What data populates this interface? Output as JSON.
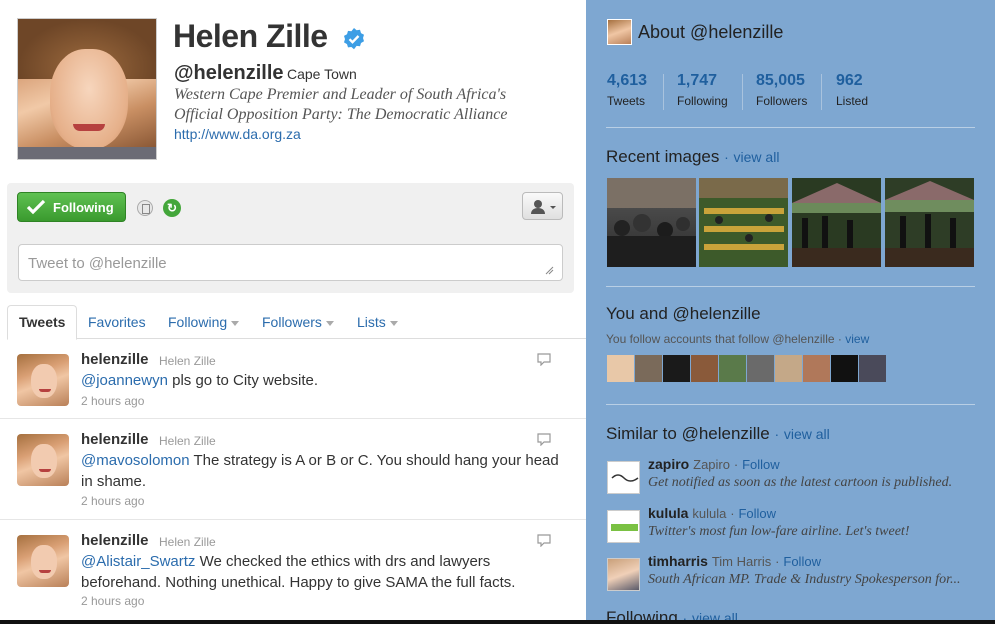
{
  "profile": {
    "name": "Helen Zille",
    "handle": "@helenzille",
    "location": "Cape Town",
    "bio": "Western Cape Premier and Leader of South Africa's Official Opposition Party: The Democratic Alliance",
    "url": "http://www.da.org.za",
    "verified": true
  },
  "actions": {
    "following_label": "Following",
    "tweet_placeholder": "Tweet to @helenzille"
  },
  "tabs": [
    {
      "label": "Tweets",
      "active": true
    },
    {
      "label": "Favorites"
    },
    {
      "label": "Following"
    },
    {
      "label": "Followers"
    },
    {
      "label": "Lists"
    }
  ],
  "tweets": [
    {
      "user": "helenzille",
      "name": "Helen Zille",
      "mention": "@joannewyn",
      "text": " pls go to City website.",
      "time": "2 hours ago"
    },
    {
      "user": "helenzille",
      "name": "Helen Zille",
      "mention": "@mavosolomon",
      "text": " The strategy is A or B or C. You should hang your head in shame.",
      "time": "2 hours ago"
    },
    {
      "user": "helenzille",
      "name": "Helen Zille",
      "mention": "@Alistair_Swartz",
      "text": " We checked the ethics with drs and lawyers beforehand. Nothing unethical. Happy to give SAMA the full facts.",
      "time": "2 hours ago"
    }
  ],
  "sidebar": {
    "about_title": "About @helenzille",
    "stats": [
      {
        "num": "4,613",
        "label": "Tweets"
      },
      {
        "num": "1,747",
        "label": "Following"
      },
      {
        "num": "85,005",
        "label": "Followers"
      },
      {
        "num": "962",
        "label": "Listed"
      }
    ],
    "recent_images_title": "Recent images",
    "view_all": "view all",
    "you_and_title": "You and @helenzille",
    "you_follow_text": "You follow accounts that follow @helenzille",
    "view": "view",
    "similar_title": "Similar to @helenzille",
    "similar": [
      {
        "user": "zapiro",
        "name": "Zapiro",
        "follow": "Follow",
        "bio": "Get notified as soon as the latest cartoon is published."
      },
      {
        "user": "kulula",
        "name": "kulula",
        "follow": "Follow",
        "bio": "Twitter's most fun low-fare airline. Let's tweet!"
      },
      {
        "user": "timharris",
        "name": "Tim Harris",
        "follow": "Follow",
        "bio": "South African MP. Trade & Industry Spokesperson for..."
      }
    ],
    "following_title": "Following",
    "dot": "·"
  },
  "colors": {
    "link": "#2b6cad",
    "follow_green": "#3a9a2e",
    "sidebar_bg": "#7ea7d1"
  }
}
